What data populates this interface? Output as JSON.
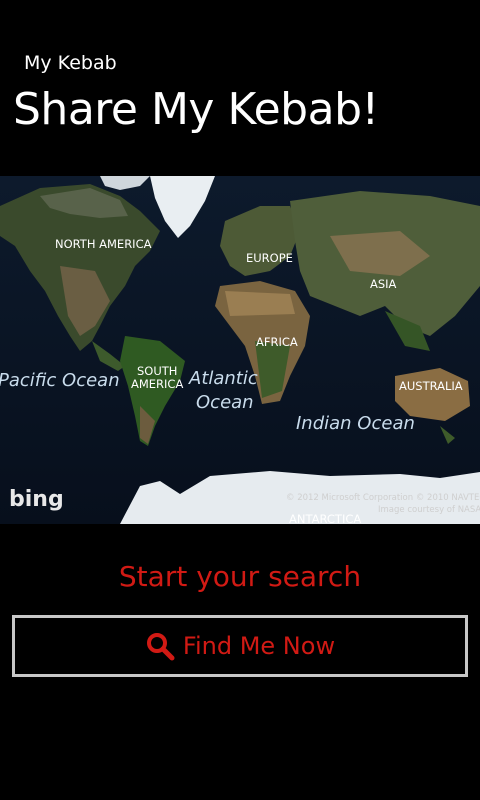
{
  "header": {
    "app_name": "My Kebab",
    "page_title": "Share My Kebab!"
  },
  "map": {
    "labels": {
      "north_america": "NORTH AMERICA",
      "europe": "EUROPE",
      "asia": "ASIA",
      "africa": "AFRICA",
      "south_america_1": "SOUTH",
      "south_america_2": "AMERICA",
      "australia": "AUSTRALIA",
      "antarctica": "ANTARCTICA",
      "pacific": "Pacific Ocean",
      "atlantic_1": "Atlantic",
      "atlantic_2": "Ocean",
      "indian": "Indian Ocean"
    },
    "logo": "bing",
    "copyright_1": "© 2012 Microsoft Corporation   © 2010 NAVTEQ",
    "copyright_2": "Image courtesy of NASA"
  },
  "search": {
    "heading": "Start your search",
    "button_label": "Find Me Now",
    "button_icon": "search-icon"
  },
  "colors": {
    "accent": "#d11a14",
    "background": "#000000",
    "button_border": "#c8c8c8"
  }
}
